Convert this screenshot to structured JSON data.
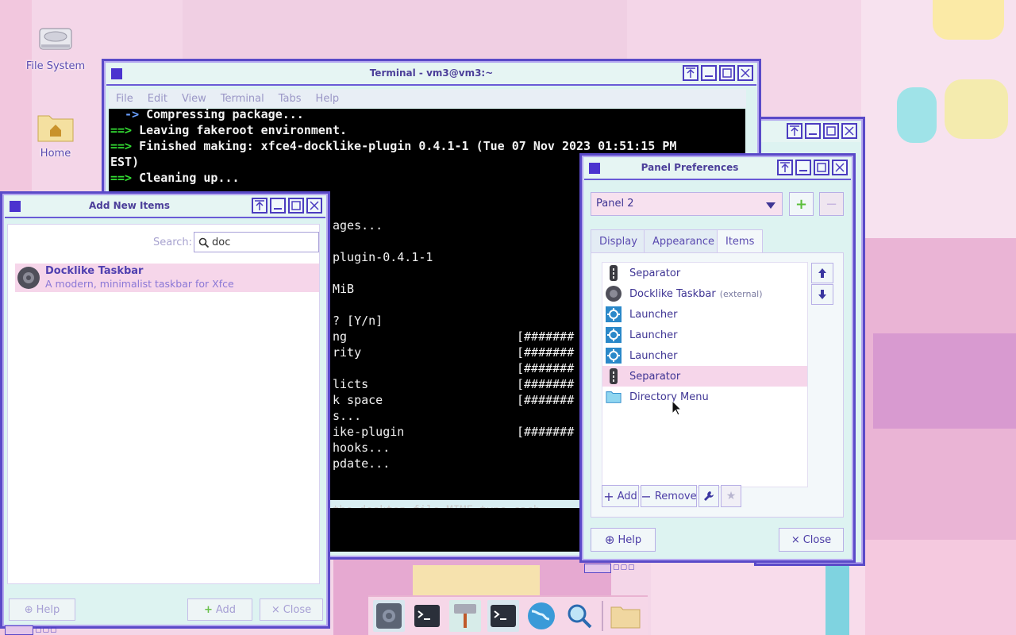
{
  "desktop": {
    "icons": [
      {
        "label": "File System",
        "icon": "hard-drive-icon"
      },
      {
        "label": "Home",
        "icon": "home-folder-icon"
      }
    ]
  },
  "terminal": {
    "title": "Terminal - vm3@vm3:~",
    "menu": [
      "File",
      "Edit",
      "View",
      "Terminal",
      "Tabs",
      "Help"
    ],
    "lines": [
      {
        "prefix": "  ->",
        "text": " Compressing package...",
        "prefix_color": "#6aa0ff"
      },
      {
        "prefix": "==>",
        "text": " Leaving fakeroot environment.",
        "prefix_color": "#33dd33"
      },
      {
        "prefix": "==>",
        "text": " Finished making: xfce4-docklike-plugin 0.4.1-1 (Tue 07 Nov 2023 01:51:15 PM",
        "prefix_color": "#33dd33"
      },
      {
        "prefix": "",
        "text": "EST)",
        "prefix_color": ""
      },
      {
        "prefix": "==>",
        "text": " Cleaning up...",
        "prefix_color": "#33dd33"
      }
    ],
    "partial_lines": [
      "ages...",
      "",
      "plugin-0.4.1-1",
      "",
      "MiB",
      "",
      "? [Y/n]",
      "ng",
      "rity",
      "",
      "licts",
      "k space",
      "s...",
      "ike-plugin",
      "hooks...",
      "pdate..."
    ],
    "progress_fragment": "[#######",
    "bottom_line": "the desktop file MIME type cach"
  },
  "add_items": {
    "title": "Add New Items",
    "search_label": "Search:",
    "search_value": "doc",
    "result": {
      "name": "Docklike Taskbar",
      "description": "A modern, minimalist taskbar for Xfce"
    },
    "help_label": "Help",
    "add_label": "Add",
    "close_label": "Close"
  },
  "panel_prefs": {
    "title": "Panel Preferences",
    "panel_select": "Panel 2",
    "tabs": [
      "Display",
      "Appearance",
      "Items"
    ],
    "active_tab": "Items",
    "items": [
      {
        "label": "Separator",
        "note": "",
        "icon": "separator-icon"
      },
      {
        "label": "Docklike Taskbar",
        "note": "(external)",
        "icon": "docklike-gear-icon"
      },
      {
        "label": "Launcher",
        "note": "",
        "icon": "launcher-icon"
      },
      {
        "label": "Launcher",
        "note": "",
        "icon": "launcher-icon"
      },
      {
        "label": "Launcher",
        "note": "",
        "icon": "launcher-icon"
      },
      {
        "label": "Separator",
        "note": "",
        "icon": "separator-icon"
      },
      {
        "label": "Directory Menu",
        "note": "",
        "icon": "folder-icon"
      }
    ],
    "selected_index": 5,
    "add_label": "Add",
    "remove_label": "Remove",
    "help_label": "Help",
    "close_label": "Close"
  },
  "taskbar": {
    "items": [
      "settings-icon",
      "terminal-icon",
      "appfinder-icon",
      "terminal-icon",
      "web-browser-icon",
      "search-icon",
      "folder-icon"
    ]
  }
}
